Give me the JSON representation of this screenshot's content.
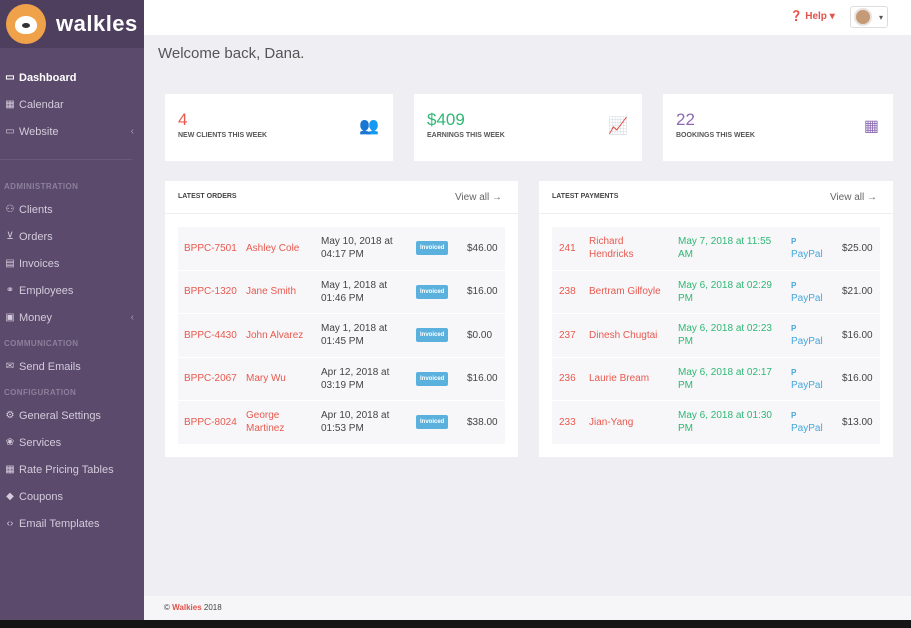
{
  "brand": {
    "name": "walkles",
    "logo_icon": "dog-logo-icon"
  },
  "topbar": {
    "help_label": "Help",
    "help_caret": "▾",
    "avatar_caret": "▾"
  },
  "sidebar": {
    "items_top": [
      {
        "label": "Dashboard",
        "icon": "monitor-icon"
      },
      {
        "label": "Calendar",
        "icon": "calendar-icon"
      },
      {
        "label": "Website",
        "icon": "laptop-icon"
      }
    ],
    "section_admin": "ADMINISTRATION",
    "items_admin": [
      {
        "label": "Clients",
        "icon": "users-icon"
      },
      {
        "label": "Orders",
        "icon": "cart-icon"
      },
      {
        "label": "Invoices",
        "icon": "invoice-icon"
      },
      {
        "label": "Employees",
        "icon": "handshake-icon"
      },
      {
        "label": "Money",
        "icon": "money-icon"
      }
    ],
    "section_comm": "COMMUNICATION",
    "items_comm": [
      {
        "label": "Send Emails",
        "icon": "envelope-icon"
      }
    ],
    "section_config": "CONFIGURATION",
    "items_config": [
      {
        "label": "General Settings",
        "icon": "cogs-icon"
      },
      {
        "label": "Services",
        "icon": "paw-icon"
      },
      {
        "label": "Rate Pricing Tables",
        "icon": "table-icon"
      },
      {
        "label": "Coupons",
        "icon": "tag-icon"
      },
      {
        "label": "Email Templates",
        "icon": "code-icon"
      }
    ]
  },
  "page_title": "Welcome back, Dana.",
  "stats": [
    {
      "value": "4",
      "label": "NEW CLIENTS THIS WEEK",
      "color": "#e8594f",
      "icon": "users-icon"
    },
    {
      "value": "$409",
      "label": "EARNINGS THIS WEEK",
      "color": "#2fb774",
      "icon": "line-chart-icon"
    },
    {
      "value": "22",
      "label": "BOOKINGS THIS WEEK",
      "color": "#8c6bb1",
      "icon": "calendar-icon"
    }
  ],
  "orders": {
    "title": "LATEST ORDERS",
    "view_all": "View all →",
    "rows": [
      {
        "id": "BPPC-7501",
        "name": "Ashley Cole",
        "date": "May 10, 2018 at 04:17 PM",
        "status": "Invoiced",
        "amount": "$46.00"
      },
      {
        "id": "BPPC-1320",
        "name": "Jane Smith",
        "date": "May 1, 2018 at 01:46 PM",
        "status": "Invoiced",
        "amount": "$16.00"
      },
      {
        "id": "BPPC-4430",
        "name": "John Alvarez",
        "date": "May 1, 2018 at 01:45 PM",
        "status": "Invoiced",
        "amount": "$0.00"
      },
      {
        "id": "BPPC-2067",
        "name": "Mary Wu",
        "date": "Apr 12, 2018 at 03:19 PM",
        "status": "Invoiced",
        "amount": "$16.00"
      },
      {
        "id": "BPPC-8024",
        "name": "George Martinez",
        "date": "Apr 10, 2018 at 01:53 PM",
        "status": "Invoiced",
        "amount": "$38.00"
      }
    ]
  },
  "payments": {
    "title": "LATEST PAYMENTS",
    "view_all": "View all →",
    "rows": [
      {
        "id": "241",
        "name": "Richard Hendricks",
        "date": "May 7, 2018 at 11:55 AM",
        "method": "PayPal",
        "amount": "$25.00"
      },
      {
        "id": "238",
        "name": "Bertram Gilfoyle",
        "date": "May 6, 2018 at 02:29 PM",
        "method": "PayPal",
        "amount": "$21.00"
      },
      {
        "id": "237",
        "name": "Dinesh Chugtai",
        "date": "May 6, 2018 at 02:23 PM",
        "method": "PayPal",
        "amount": "$16.00"
      },
      {
        "id": "236",
        "name": "Laurie Bream",
        "date": "May 6, 2018 at 02:17 PM",
        "method": "PayPal",
        "amount": "$16.00"
      },
      {
        "id": "233",
        "name": "Jian-Yang",
        "date": "May 6, 2018 at 01:30 PM",
        "method": "PayPal",
        "amount": "$13.00"
      }
    ]
  },
  "footer": {
    "copyright": "©",
    "brand": "Walkies",
    "year": "2018"
  }
}
